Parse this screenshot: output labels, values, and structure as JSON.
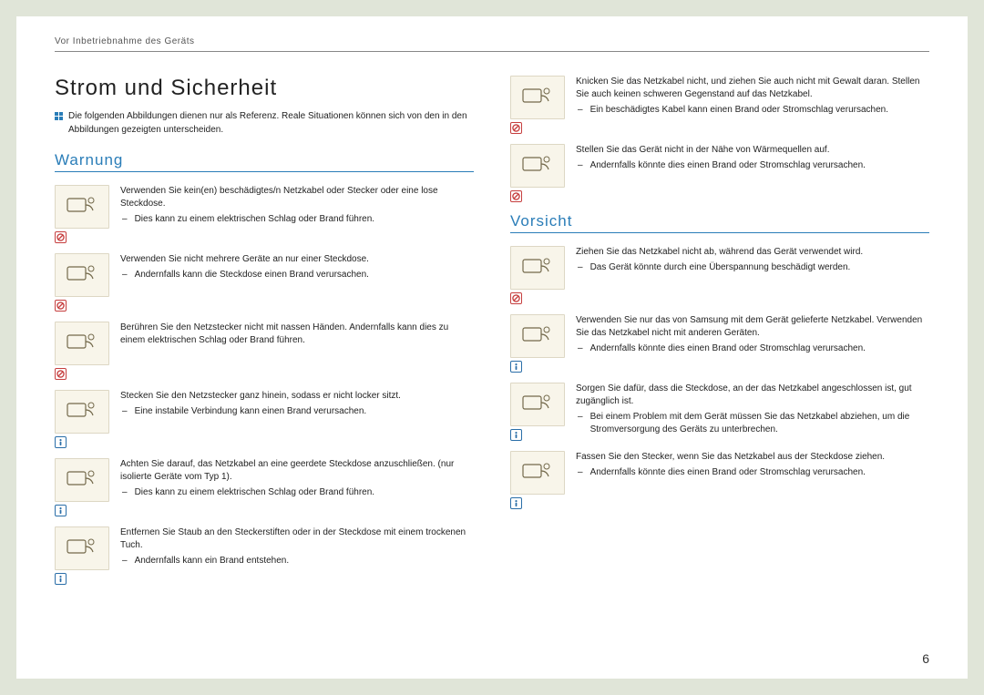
{
  "header": "Vor Inbetriebnahme des Geräts",
  "title": "Strom und Sicherheit",
  "intro": "Die folgenden Abbildungen dienen nur als Referenz. Reale Situationen können sich von den in den Abbildungen gezeigten unterscheiden.",
  "pagenum": "6",
  "warnung": {
    "heading": "Warnung",
    "items": [
      {
        "main": "Verwenden Sie kein(en) beschädigtes/n Netzkabel oder Stecker oder eine lose Steckdose.",
        "sub": "Dies kann zu einem elektrischen Schlag oder Brand führen.",
        "badge": "warn"
      },
      {
        "main": "Verwenden Sie nicht mehrere Geräte an nur einer Steckdose.",
        "sub": "Andernfalls kann die Steckdose einen Brand verursachen.",
        "badge": "warn"
      },
      {
        "main": "Berühren Sie den Netzstecker nicht mit nassen Händen. Andernfalls kann dies zu einem elektrischen Schlag oder Brand führen.",
        "sub": "",
        "badge": "warn"
      },
      {
        "main": "Stecken Sie den Netzstecker ganz hinein, sodass er nicht locker sitzt.",
        "sub": "Eine instabile Verbindung kann einen Brand verursachen.",
        "badge": "info"
      },
      {
        "main": "Achten Sie darauf, das Netzkabel an eine geerdete Steckdose anzuschließen. (nur isolierte Geräte vom Typ 1).",
        "sub": "Dies kann zu einem elektrischen Schlag oder Brand führen.",
        "badge": "info"
      },
      {
        "main": "Entfernen Sie Staub an den Steckerstiften oder in der Steckdose mit einem trockenen Tuch.",
        "sub": "Andernfalls kann ein Brand entstehen.",
        "badge": "info"
      }
    ]
  },
  "right_warn": [
    {
      "main": "Knicken Sie das Netzkabel nicht, und ziehen Sie auch nicht mit Gewalt daran. Stellen Sie auch keinen schweren Gegenstand auf das Netzkabel.",
      "sub": "Ein beschädigtes Kabel kann einen Brand oder Stromschlag verursachen.",
      "badge": "warn"
    },
    {
      "main": "Stellen Sie das Gerät nicht in der Nähe von Wärmequellen auf.",
      "sub": "Andernfalls könnte dies einen Brand oder Stromschlag verursachen.",
      "badge": "warn"
    }
  ],
  "vorsicht": {
    "heading": "Vorsicht",
    "items": [
      {
        "main": "Ziehen Sie das Netzkabel nicht ab, während das Gerät verwendet wird.",
        "sub": "Das Gerät könnte durch eine Überspannung beschädigt werden.",
        "badge": "warn"
      },
      {
        "main": "Verwenden Sie nur das von Samsung mit dem Gerät gelieferte Netzkabel. Verwenden Sie das Netzkabel nicht mit anderen Geräten.",
        "sub": "Andernfalls könnte dies einen Brand oder Stromschlag verursachen.",
        "badge": "info"
      },
      {
        "main": "Sorgen Sie dafür, dass die Steckdose, an der das Netzkabel angeschlossen ist, gut zugänglich ist.",
        "sub": "Bei einem Problem mit dem Gerät müssen Sie das Netzkabel abziehen, um die Stromversorgung des Geräts zu unterbrechen.",
        "badge": "info"
      },
      {
        "main": "Fassen Sie den Stecker, wenn Sie das Netzkabel aus der Steckdose ziehen.",
        "sub": "Andernfalls könnte dies einen Brand oder Stromschlag verursachen.",
        "badge": "info"
      }
    ]
  }
}
